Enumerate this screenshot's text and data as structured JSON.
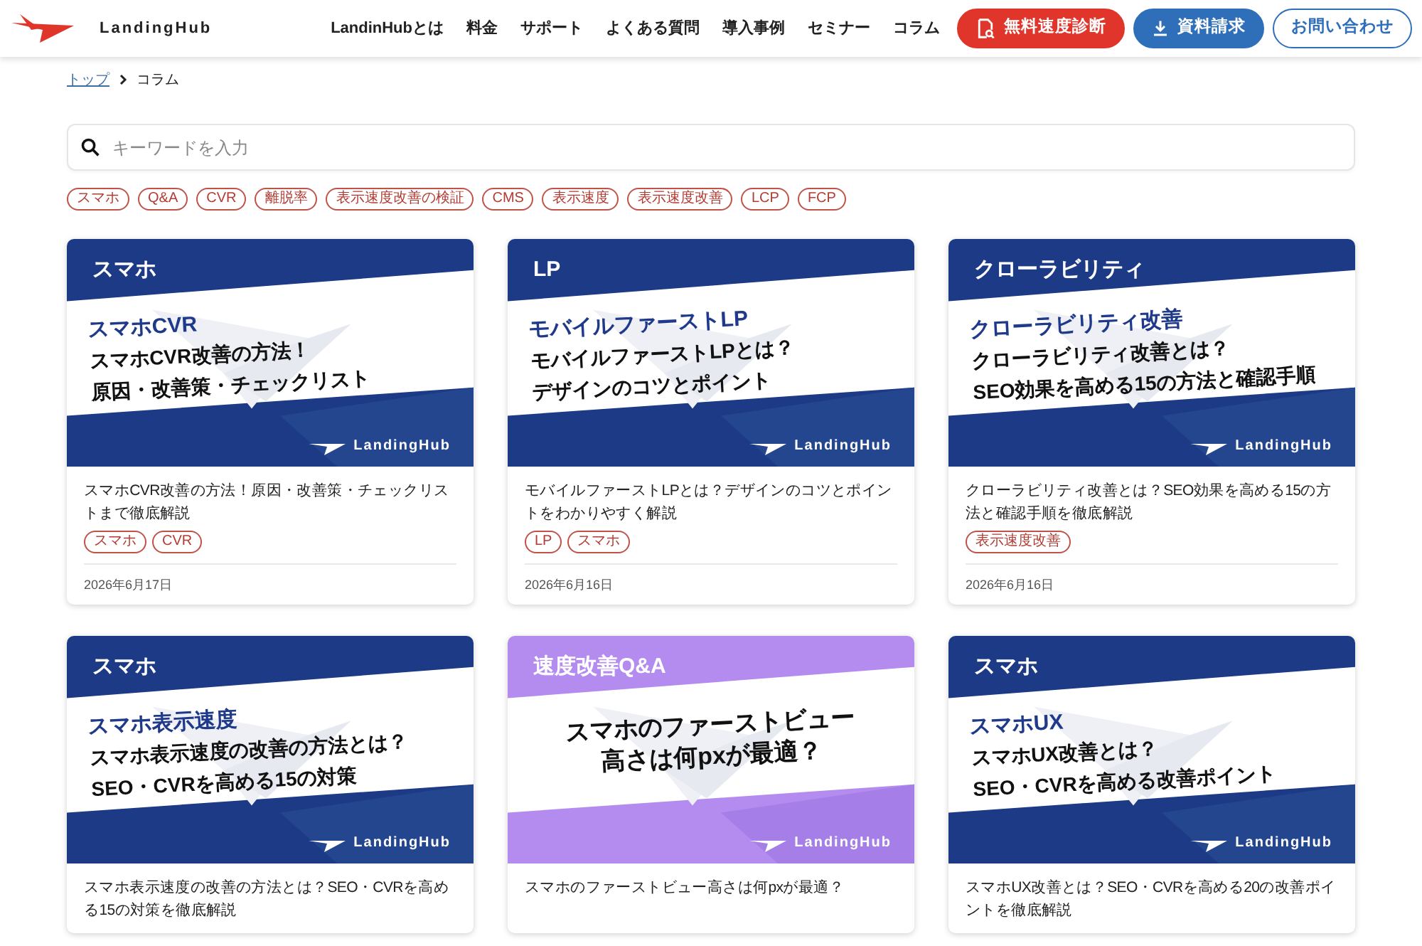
{
  "header": {
    "logo_text": "LandingHub",
    "nav": [
      "LandinHubとは",
      "料金",
      "サポート",
      "よくある質問",
      "導入事例",
      "セミナー",
      "コラム"
    ],
    "buttons": [
      {
        "kind": "red",
        "label": "無料速度診断"
      },
      {
        "kind": "blue",
        "label": "資料請求"
      },
      {
        "kind": "outline",
        "label": "お問い合わせ"
      }
    ]
  },
  "breadcrumb": {
    "items": [
      "トップ",
      "コラム"
    ]
  },
  "search": {
    "placeholder": "キーワードを入力"
  },
  "tags": [
    "スマホ",
    "Q&A",
    "CVR",
    "離脱率",
    "表示速度改善の検証",
    "CMS",
    "表示速度",
    "表示速度改善",
    "LCP",
    "FCP"
  ],
  "cards": [
    {
      "thumbnail": {
        "kind": "navy",
        "category": "スマホ",
        "subtitle": "スマホCVR",
        "headline": [
          "スマホCVR改善の方法！",
          "原因・改善策・チェックリスト"
        ],
        "brand": "LandingHub"
      },
      "title": "スマホCVR改善の方法！原因・改善策・チェックリストまで徹底解説",
      "tags": [
        "スマホ",
        "CVR"
      ],
      "date": "2026年6月17日"
    },
    {
      "thumbnail": {
        "kind": "navy",
        "category": "LP",
        "subtitle": "モバイルファーストLP",
        "headline": [
          "モバイルファーストLPとは？",
          "デザインのコツとポイント"
        ],
        "brand": "LandingHub"
      },
      "title": "モバイルファーストLPとは？デザインのコツとポイントをわかりやすく解説",
      "tags": [
        "LP",
        "スマホ"
      ],
      "date": "2026年6月16日"
    },
    {
      "thumbnail": {
        "kind": "navy",
        "category": "クローラビリティ",
        "subtitle": "クローラビリティ改善",
        "headline": [
          "クローラビリティ改善とは？",
          "SEO効果を高める15の方法と確認手順"
        ],
        "brand": "LandingHub"
      },
      "title": "クローラビリティ改善とは？SEO効果を高める15の方法と確認手順を徹底解説",
      "tags": [
        "表示速度改善"
      ],
      "date": "2026年6月16日"
    },
    {
      "thumbnail": {
        "kind": "navy",
        "category": "スマホ",
        "subtitle": "スマホ表示速度",
        "headline": [
          "スマホ表示速度の改善の方法とは？",
          "SEO・CVRを高める15の対策"
        ],
        "brand": "LandingHub"
      },
      "title": "スマホ表示速度の改善の方法とは？SEO・CVRを高める15の対策を徹底解説"
    },
    {
      "thumbnail": {
        "kind": "purple",
        "category": "速度改善Q&A",
        "headline": [
          "スマホのファーストビュー",
          "高さは何pxが最適？"
        ],
        "brand": "LandingHub"
      },
      "title": "スマホのファーストビュー高さは何pxが最適？"
    },
    {
      "thumbnail": {
        "kind": "navy",
        "category": "スマホ",
        "subtitle": "スマホUX",
        "headline": [
          "スマホUX改善とは？",
          "SEO・CVRを高める改善ポイント"
        ],
        "brand": "LandingHub"
      },
      "title": "スマホUX改善とは？SEO・CVRを高める20の改善ポイントを徹底解説"
    }
  ]
}
